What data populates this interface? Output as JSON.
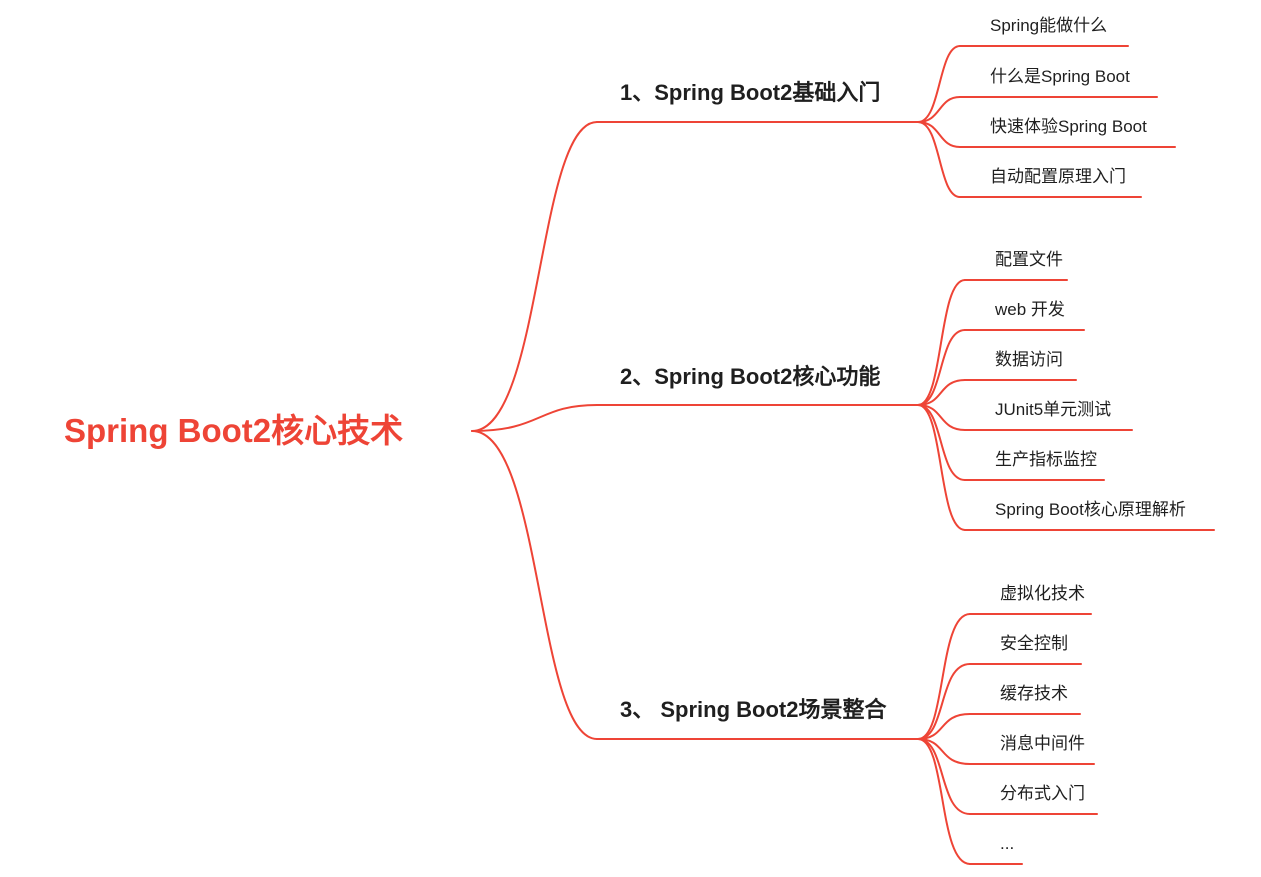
{
  "root": {
    "label": "Spring Boot2核心技术"
  },
  "branches": [
    {
      "label": "1、Spring Boot2基础入门",
      "children": [
        {
          "label": "Spring能做什么"
        },
        {
          "label": "什么是Spring Boot"
        },
        {
          "label": "快速体验Spring Boot"
        },
        {
          "label": "自动配置原理入门"
        }
      ]
    },
    {
      "label": "2、Spring Boot2核心功能",
      "children": [
        {
          "label": "配置文件"
        },
        {
          "label": "web 开发"
        },
        {
          "label": "数据访问"
        },
        {
          "label": "JUnit5单元测试"
        },
        {
          "label": "生产指标监控"
        },
        {
          "label": "Spring Boot核心原理解析"
        }
      ]
    },
    {
      "label": "3、 Spring Boot2场景整合",
      "children": [
        {
          "label": "虚拟化技术"
        },
        {
          "label": "安全控制"
        },
        {
          "label": "缓存技术"
        },
        {
          "label": "消息中间件"
        },
        {
          "label": "分布式入门"
        },
        {
          "label": "..."
        }
      ]
    }
  ],
  "colors": {
    "line": "#ee4436",
    "root_text": "#ee4436",
    "node_text": "#1f1f1f"
  }
}
